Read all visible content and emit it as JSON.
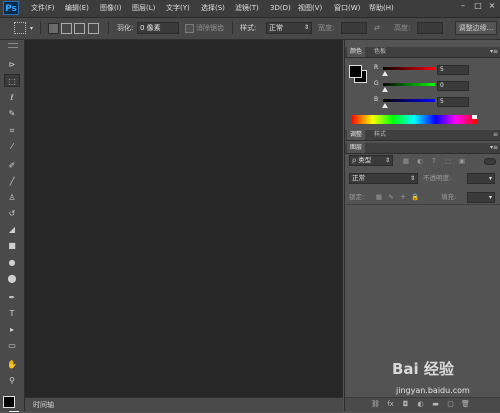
{
  "app": {
    "logo": "Ps"
  },
  "menu": [
    "文件(F)",
    "编辑(E)",
    "图像(I)",
    "图层(L)",
    "文字(Y)",
    "选择(S)",
    "滤镜(T)",
    "3D(D)",
    "视图(V)",
    "窗口(W)",
    "帮助(H)"
  ],
  "window_controls": {
    "minimize": "–",
    "maximize": "□",
    "close": "×"
  },
  "options_bar": {
    "feather_label": "羽化:",
    "feather_value": "0 像素",
    "antialias_label": "消除锯齿",
    "style_label": "样式:",
    "style_value": "正常",
    "width_label": "宽度:",
    "height_label": "高度:",
    "refine_edge_button": "调整边缘..."
  },
  "tools": [
    "移动工具",
    "矩形选框工具",
    "套索工具",
    "快速选择工具",
    "裁剪工具",
    "吸管工具",
    "污点修复画笔工具",
    "画笔工具",
    "仿制图章工具",
    "历史记录画笔工具",
    "橡皮擦工具",
    "渐变工具",
    "模糊工具",
    "减淡工具",
    "钢笔工具",
    "横排文字工具",
    "路径选择工具",
    "矩形工具",
    "抓手工具",
    "缩放工具"
  ],
  "timeline": {
    "tab": "时间轴"
  },
  "color_panel": {
    "tabs": [
      "颜色",
      "色板"
    ],
    "foreground": "#000000",
    "background": "#000000",
    "channels": [
      {
        "label": "R",
        "value": "5",
        "color": "#ff2020"
      },
      {
        "label": "G",
        "value": "0",
        "color": "#20c020"
      },
      {
        "label": "B",
        "value": "5",
        "color": "#2040ff"
      }
    ]
  },
  "adjust_panel": {
    "tabs": [
      "调整",
      "样式"
    ]
  },
  "layers_panel": {
    "tab": "图层",
    "filter_kind": "类型",
    "blend_mode": "正常",
    "opacity_label": "不透明度:",
    "lock_label": "锁定:",
    "fill_label": "填充:"
  },
  "watermark": {
    "logo": "Bai 经验",
    "url": "jingyan.baidu.com"
  }
}
